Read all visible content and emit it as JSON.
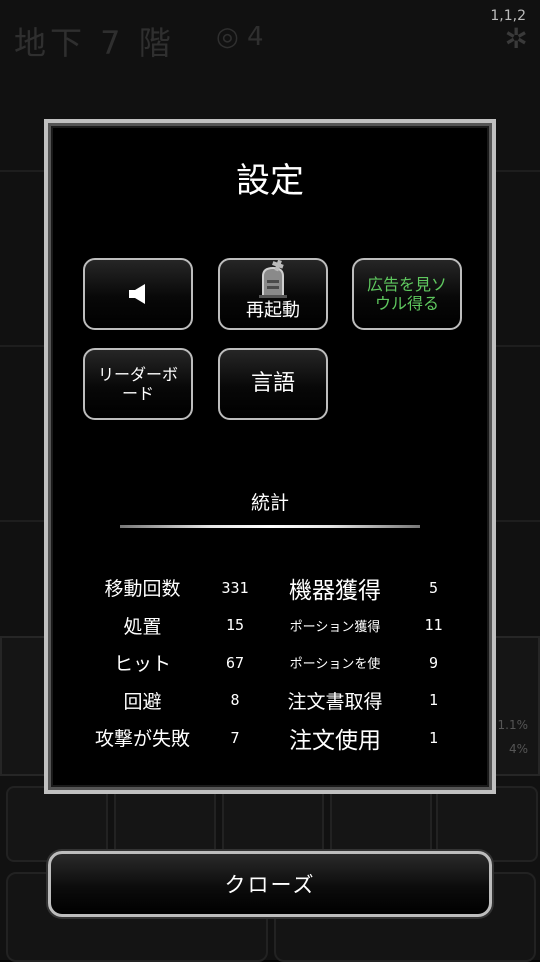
{
  "version": "1,1,2",
  "background": {
    "floor_title": "地下 7 階",
    "soul_count": "4",
    "pct_a": "1.1%",
    "pct_b": "4%"
  },
  "dialog": {
    "title": "設定",
    "buttons": {
      "restart": "再起動",
      "ad_souls": "広告を見ソウル得る",
      "leaderboard": "リーダーボード",
      "language": "言語"
    },
    "stats_title": "統計",
    "stats": [
      {
        "label": "移動回数",
        "value": "331",
        "label2": "機器獲得",
        "value2": "5"
      },
      {
        "label": "処置",
        "value": "15",
        "label2": "ポーション獲得",
        "value2": "11"
      },
      {
        "label": "ヒット",
        "value": "67",
        "label2": "ポーションを使",
        "value2": "9"
      },
      {
        "label": "回避",
        "value": "8",
        "label2": "注文書取得",
        "value2": "1"
      },
      {
        "label": "攻撃が失敗",
        "value": "7",
        "label2": "注文使用",
        "value2": "1"
      }
    ]
  },
  "close_label": "クローズ",
  "colors": {
    "ad_text": "#5fc85f",
    "border": "#bdbdbd",
    "dialog_bg": "#000000"
  },
  "icons": {
    "sound": "speaker-icon",
    "restart": "tombstone-icon",
    "settings": "gear-icon",
    "soul": "soul-icon"
  }
}
